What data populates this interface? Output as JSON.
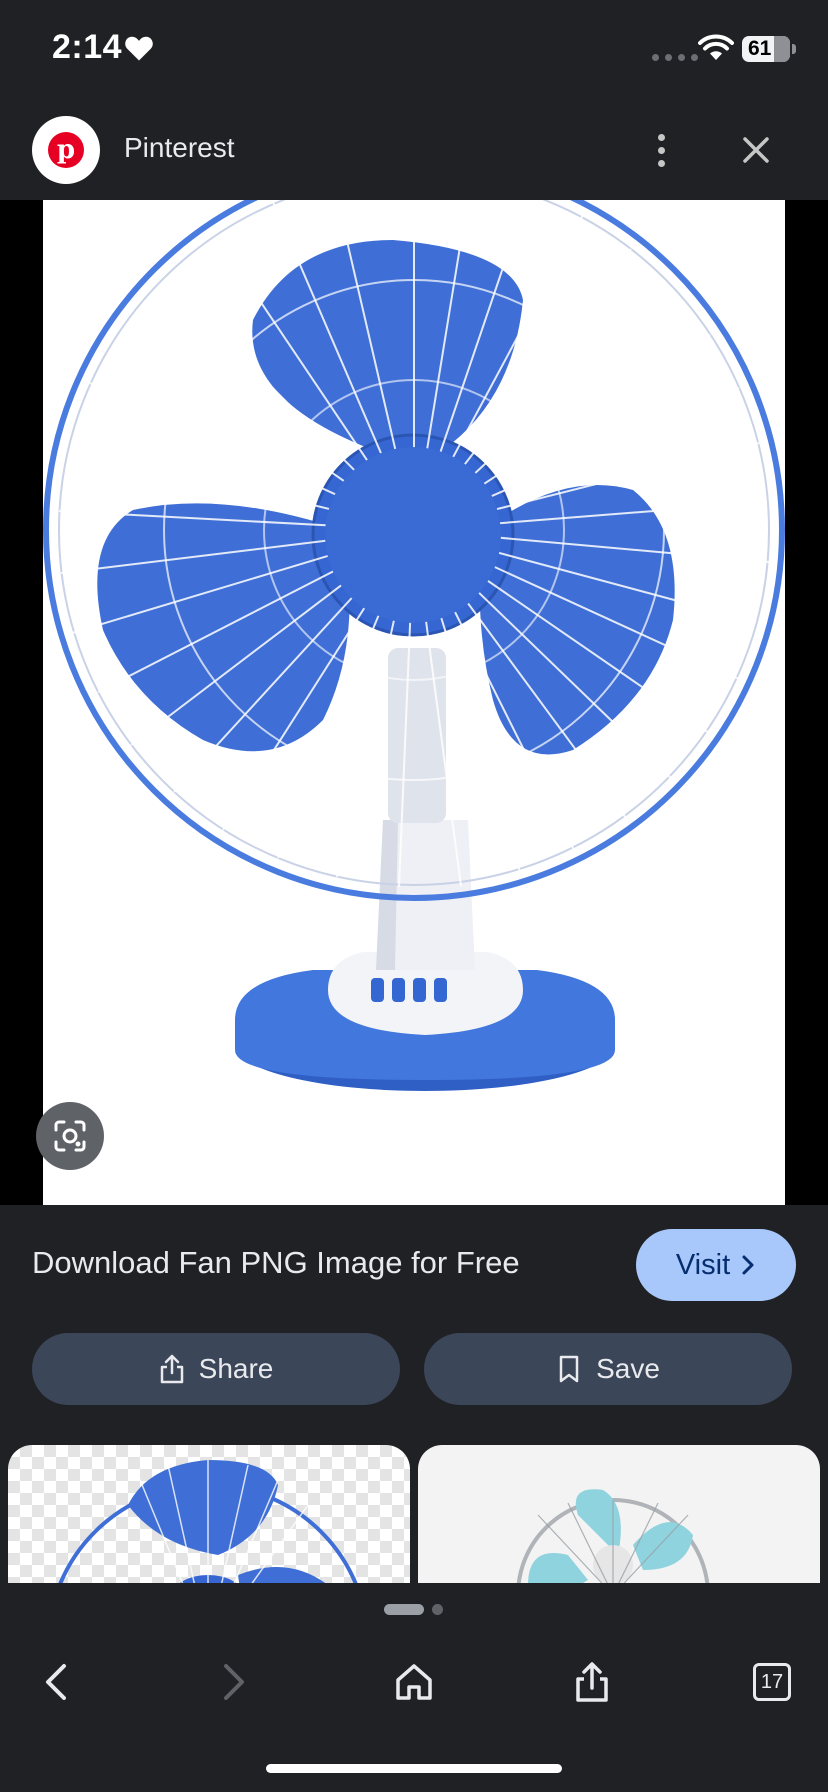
{
  "status_bar": {
    "time": "2:14",
    "battery_level": "61",
    "icons": [
      "heart-icon",
      "signal-dots-icon",
      "wifi-icon",
      "battery-icon"
    ]
  },
  "header": {
    "site_name": "Pinterest",
    "logo_letter": "p",
    "logo_color": "#e60023",
    "icons": [
      "more-vert-icon",
      "close-icon"
    ]
  },
  "image": {
    "subject": "blue-table-fan",
    "fan_color": "#3f6fd6",
    "lens_icon": "google-lens-icon"
  },
  "result": {
    "title": "Download Fan PNG Image for Free",
    "visit_label": "Visit",
    "visit_color": "#a8c7fa"
  },
  "actions": {
    "share_label": "Share",
    "save_label": "Save"
  },
  "pager": {
    "pages": 2,
    "current": 1
  },
  "bottom_nav": {
    "tab_count": "17",
    "icons": [
      "back-icon",
      "forward-icon",
      "home-icon",
      "share-icon",
      "tabs-icon"
    ]
  }
}
